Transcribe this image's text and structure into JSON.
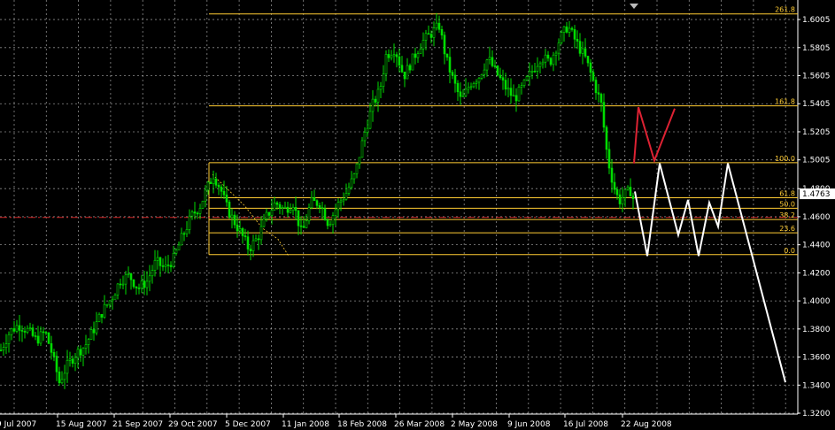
{
  "chart_data": {
    "type": "candlestick-with-projection",
    "ylim": [
      1.32,
      1.61
    ],
    "y_ticks": [
      "1.6005",
      "1.5805",
      "1.5605",
      "1.5405",
      "1.5205",
      "1.5005",
      "1.4800",
      "1.4600",
      "1.4400",
      "1.4200",
      "1.4000",
      "1.3800",
      "1.3600",
      "1.3400",
      "1.3200"
    ],
    "current_price": "1.4763",
    "x_ticks": [
      "9 Jul 2007",
      "15 Aug 2007",
      "21 Sep 2007",
      "29 Oct 2007",
      "5 Dec 2007",
      "11 Jan 2008",
      "18 Feb 2008",
      "26 Mar 2008",
      "2 May 2008",
      "9 Jun 2008",
      "16 Jul 2008",
      "22 Aug 2008"
    ],
    "fib_levels": [
      {
        "label": "261.8",
        "value": 1.6045
      },
      {
        "label": "161.8",
        "value": 1.539
      },
      {
        "label": "100.0",
        "value": 1.4985
      },
      {
        "label": "61.8",
        "value": 1.4735
      },
      {
        "label": "50.0",
        "value": 1.466
      },
      {
        "label": "38.2",
        "value": 1.458
      },
      {
        "label": "23.6",
        "value": 1.4485
      },
      {
        "label": "0.0",
        "value": 1.433
      }
    ],
    "red_dashed_level": 1.4595,
    "price_path": [
      [
        0,
        1.365
      ],
      [
        10,
        1.378
      ],
      [
        20,
        1.383
      ],
      [
        30,
        1.379
      ],
      [
        40,
        1.372
      ],
      [
        50,
        1.378
      ],
      [
        58,
        1.362
      ],
      [
        66,
        1.342
      ],
      [
        74,
        1.353
      ],
      [
        84,
        1.362
      ],
      [
        95,
        1.368
      ],
      [
        105,
        1.38
      ],
      [
        115,
        1.393
      ],
      [
        125,
        1.402
      ],
      [
        135,
        1.415
      ],
      [
        145,
        1.418
      ],
      [
        155,
        1.409
      ],
      [
        165,
        1.414
      ],
      [
        175,
        1.428
      ],
      [
        185,
        1.423
      ],
      [
        195,
        1.43
      ],
      [
        205,
        1.446
      ],
      [
        215,
        1.46
      ],
      [
        225,
        1.468
      ],
      [
        233,
        1.48
      ],
      [
        240,
        1.49
      ],
      [
        248,
        1.48
      ],
      [
        256,
        1.465
      ],
      [
        264,
        1.456
      ],
      [
        272,
        1.447
      ],
      [
        280,
        1.437
      ],
      [
        290,
        1.445
      ],
      [
        300,
        1.46
      ],
      [
        310,
        1.47
      ],
      [
        320,
        1.465
      ],
      [
        330,
        1.47
      ],
      [
        340,
        1.447
      ],
      [
        350,
        1.47
      ],
      [
        360,
        1.47
      ],
      [
        370,
        1.455
      ],
      [
        380,
        1.468
      ],
      [
        390,
        1.477
      ],
      [
        400,
        1.49
      ],
      [
        410,
        1.518
      ],
      [
        420,
        1.54
      ],
      [
        428,
        1.55
      ],
      [
        435,
        1.575
      ],
      [
        445,
        1.58
      ],
      [
        455,
        1.56
      ],
      [
        465,
        1.572
      ],
      [
        475,
        1.584
      ],
      [
        485,
        1.59
      ],
      [
        495,
        1.596
      ],
      [
        503,
        1.572
      ],
      [
        512,
        1.555
      ],
      [
        520,
        1.542
      ],
      [
        530,
        1.555
      ],
      [
        540,
        1.56
      ],
      [
        550,
        1.573
      ],
      [
        560,
        1.562
      ],
      [
        570,
        1.552
      ],
      [
        580,
        1.544
      ],
      [
        590,
        1.553
      ],
      [
        600,
        1.564
      ],
      [
        610,
        1.574
      ],
      [
        620,
        1.57
      ],
      [
        630,
        1.585
      ],
      [
        640,
        1.596
      ],
      [
        650,
        1.584
      ],
      [
        660,
        1.573
      ],
      [
        670,
        1.555
      ],
      [
        678,
        1.54
      ],
      [
        685,
        1.502
      ],
      [
        692,
        1.482
      ],
      [
        698,
        1.471
      ],
      [
        705,
        1.476
      ],
      [
        712,
        1.479
      ],
      [
        716,
        1.467
      ]
    ],
    "projection_white": [
      [
        717,
        1.478
      ],
      [
        731,
        1.432
      ],
      [
        745,
        1.498
      ],
      [
        766,
        1.447
      ],
      [
        777,
        1.472
      ],
      [
        789,
        1.432
      ],
      [
        801,
        1.47
      ],
      [
        811,
        1.453
      ],
      [
        822,
        1.498
      ],
      [
        887,
        1.342
      ]
    ],
    "projection_red": [
      [
        716,
        1.498
      ],
      [
        721,
        1.538
      ],
      [
        739,
        1.5
      ],
      [
        762,
        1.537
      ]
    ],
    "secondary_dashed": [
      [
        240,
        1.49
      ],
      [
        258,
        1.479
      ],
      [
        276,
        1.468
      ],
      [
        296,
        1.452
      ],
      [
        314,
        1.444
      ],
      [
        326,
        1.432
      ]
    ],
    "colors": {
      "background": "#000000",
      "grid": "#c8c8c8",
      "candles": "#00dd00",
      "fib": "#ffcc33",
      "projection": "#ffffff",
      "projection_alt": "#dd2233",
      "current_price_label_bg": "#ffffff",
      "current_price_label_text": "#000000"
    }
  }
}
